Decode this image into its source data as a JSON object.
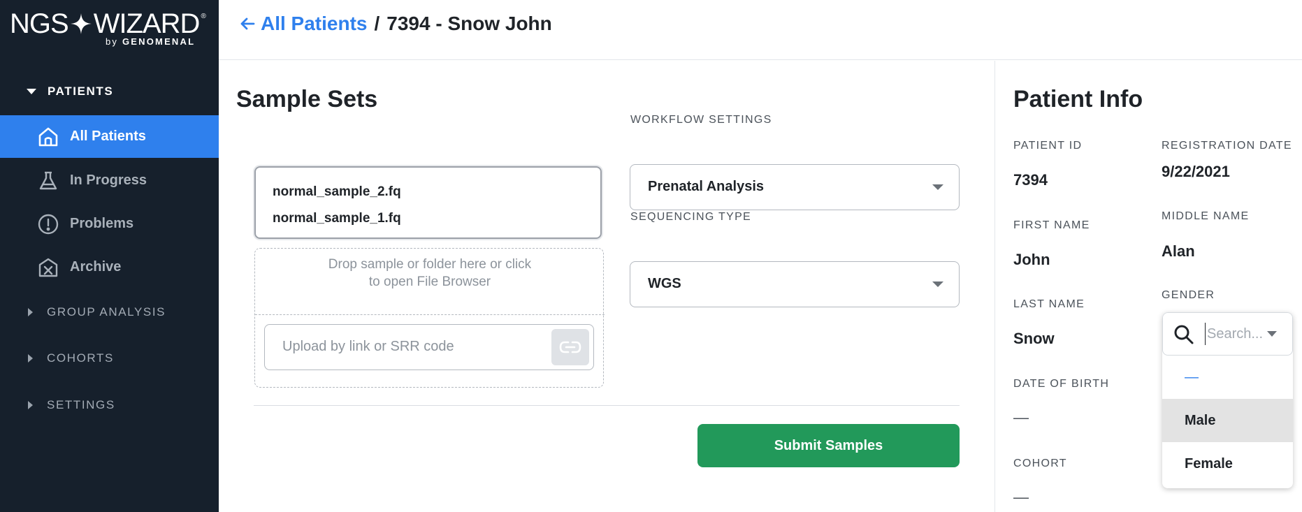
{
  "brand": {
    "logo_left": "NGS",
    "logo_right": "WIZARD",
    "logo_reg": "®",
    "logo_by": "by",
    "logo_company": "GENOMENAL"
  },
  "sidebar": {
    "patients_section": "PATIENTS",
    "items": [
      {
        "label": "All Patients",
        "icon": "home-icon",
        "active": true
      },
      {
        "label": "In Progress",
        "icon": "flask-icon",
        "active": false
      },
      {
        "label": "Problems",
        "icon": "alert-circle-icon",
        "active": false
      },
      {
        "label": "Archive",
        "icon": "archive-icon",
        "active": false
      }
    ],
    "collapsed_sections": [
      "GROUP ANALYSIS",
      "COHORTS",
      "SETTINGS"
    ]
  },
  "header": {
    "back_link": "All Patients",
    "separator": "/",
    "current": "7394 - Snow John"
  },
  "main": {
    "title": "Sample Sets",
    "files": [
      "normal_sample_2.fq",
      "normal_sample_1.fq"
    ],
    "drop_text": "Drop sample or folder here or click to open File Browser",
    "upload_placeholder": "Upload by link or SRR code",
    "workflow_label": "WORKFLOW SETTINGS",
    "workflow_value": "Prenatal Analysis",
    "sequencing_label": "SEQUENCING TYPE",
    "sequencing_value": "WGS",
    "submit_label": "Submit Samples"
  },
  "patient_info": {
    "title": "Patient Info",
    "patient_id_label": "PATIENT ID",
    "patient_id": "7394",
    "registration_label": "REGISTRATION DATE",
    "registration_date": "9/22/2021",
    "first_name_label": "FIRST NAME",
    "first_name": "John",
    "middle_name_label": "MIDDLE NAME",
    "middle_name": "Alan",
    "last_name_label": "LAST NAME",
    "last_name": "Snow",
    "gender_label": "GENDER",
    "dob_label": "DATE OF BIRTH",
    "dob": "—",
    "cohort_label": "COHORT",
    "cohort": "—"
  },
  "gender_dropdown": {
    "search_placeholder": "Search...",
    "options": [
      "—",
      "Male",
      "Female"
    ],
    "hovered": "Male"
  },
  "colors": {
    "sidebar_bg": "#16202c",
    "accent": "#2f80ed",
    "submit": "#22995a"
  }
}
